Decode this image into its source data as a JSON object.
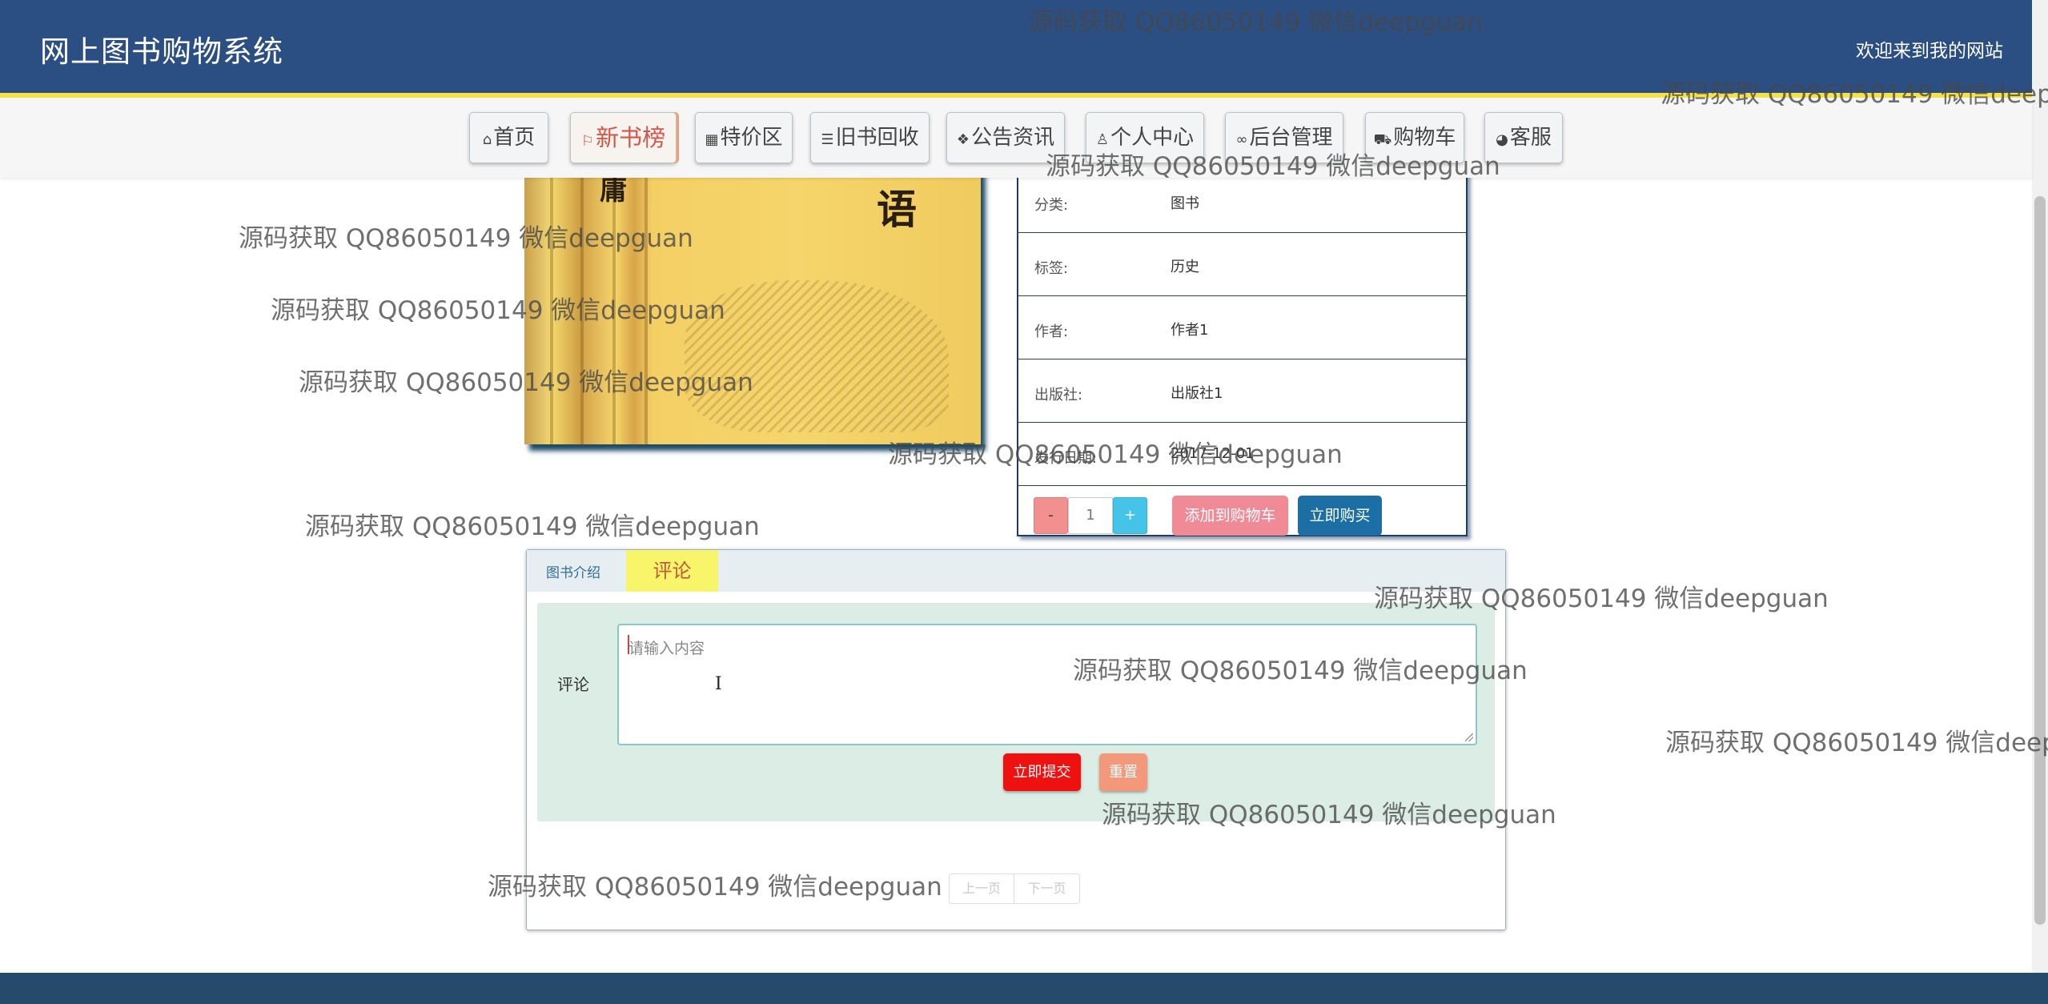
{
  "header": {
    "site_title": "网上图书购物系统",
    "welcome_text": "欢迎来到我的网站"
  },
  "nav": {
    "items": [
      {
        "label": "首页",
        "icon": "home-icon",
        "glyph": "⌂"
      },
      {
        "label": "新书榜",
        "icon": "flag-icon",
        "glyph": "⚐",
        "active": true
      },
      {
        "label": "特价区",
        "icon": "grid-icon",
        "glyph": "▦"
      },
      {
        "label": "旧书回收",
        "icon": "sliders-icon",
        "glyph": "☰"
      },
      {
        "label": "公告资讯",
        "icon": "layers-icon",
        "glyph": "❖"
      },
      {
        "label": "个人中心",
        "icon": "user-icon",
        "glyph": "♙"
      },
      {
        "label": "后台管理",
        "icon": "link-icon",
        "glyph": "∞"
      },
      {
        "label": "购物车",
        "icon": "cart-icon",
        "glyph": "⛟"
      },
      {
        "label": "客服",
        "icon": "chat-icon",
        "glyph": "◕"
      }
    ]
  },
  "book": {
    "cover_icon": "book-cover-image",
    "cover_big_char": "语",
    "cover_spine_char": "庸",
    "details": [
      {
        "label": "分类:",
        "value": "图书"
      },
      {
        "label": "标签:",
        "value": "历史"
      },
      {
        "label": "作者:",
        "value": "作者1"
      },
      {
        "label": "出版社:",
        "value": "出版社1"
      },
      {
        "label": "发行日期:",
        "value": "2017-12-01"
      }
    ],
    "quantity": {
      "minus": "-",
      "value": "1",
      "plus": "+"
    },
    "add_to_cart_label": "添加到购物车",
    "buy_now_label": "立即购买"
  },
  "comments": {
    "tabs": [
      {
        "label": "图书介绍",
        "active": false
      },
      {
        "label": "评论",
        "active": true
      }
    ],
    "form": {
      "field_label": "评论",
      "placeholder": "请输入内容",
      "submit_label": "立即提交",
      "reset_label": "重置"
    },
    "pager": {
      "prev_label": "上一页",
      "next_label": "下一页"
    }
  },
  "colors": {
    "header_bg": "#2c4f83",
    "header_accent": "#f3e24a",
    "active_tab_bg": "#f9f56b",
    "submit_bg": "#ef1010",
    "buy_bg": "#1b6fa5",
    "cart_bg": "#f08a96",
    "footer_bg": "#254a6c"
  },
  "watermark": {
    "text": "源码获取 QQ86050149 微信deepguan",
    "text_cut_1": "源码获取 QQ86050149 微信deepg",
    "text_cut_2": "源码获取 QQ86050149 微信deep"
  }
}
